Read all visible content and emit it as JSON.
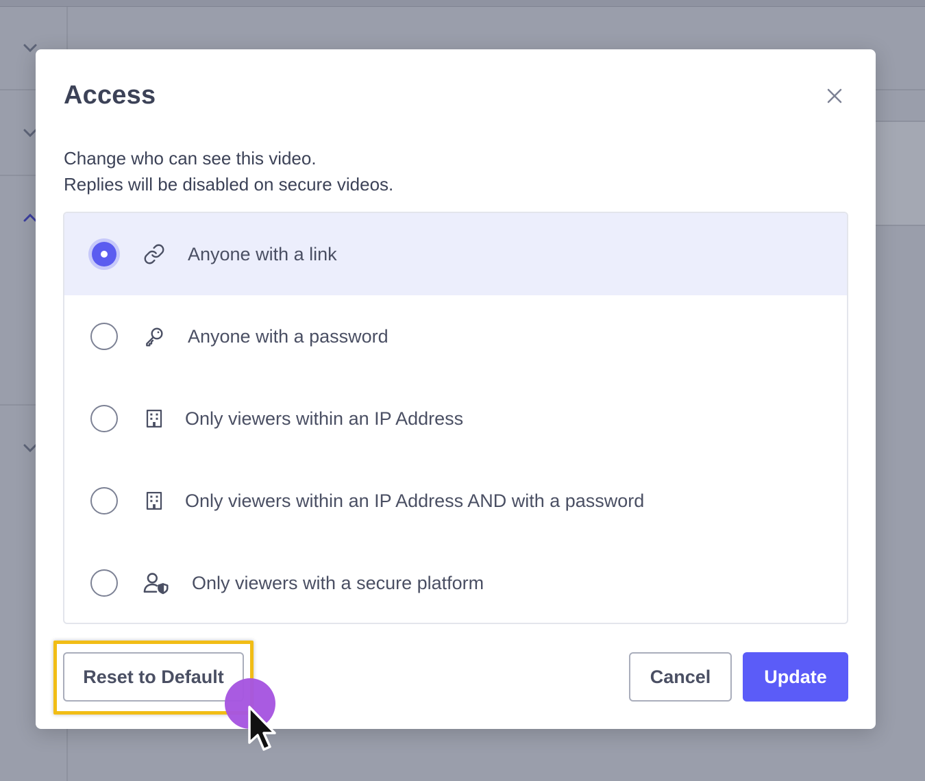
{
  "modal": {
    "title": "Access",
    "description_line1": "Change who can see this video.",
    "description_line2": "Replies will be disabled on secure videos.",
    "options": [
      {
        "label": "Anyone with a link",
        "icon": "link-icon",
        "selected": true
      },
      {
        "label": "Anyone with a password",
        "icon": "key-icon",
        "selected": false
      },
      {
        "label": "Only viewers within an IP Address",
        "icon": "building-icon",
        "selected": false
      },
      {
        "label": "Only viewers within an IP Address AND with a password",
        "icon": "building-icon",
        "selected": false
      },
      {
        "label": "Only viewers with a secure platform",
        "icon": "user-shield-icon",
        "selected": false
      }
    ],
    "buttons": {
      "reset": "Reset to Default",
      "cancel": "Cancel",
      "update": "Update"
    }
  },
  "colors": {
    "accent": "#5b5cf8",
    "selected_row": "#eceefc",
    "highlight": "#f1bd16",
    "click_dot": "#a656e0",
    "text": "#3c4257"
  }
}
